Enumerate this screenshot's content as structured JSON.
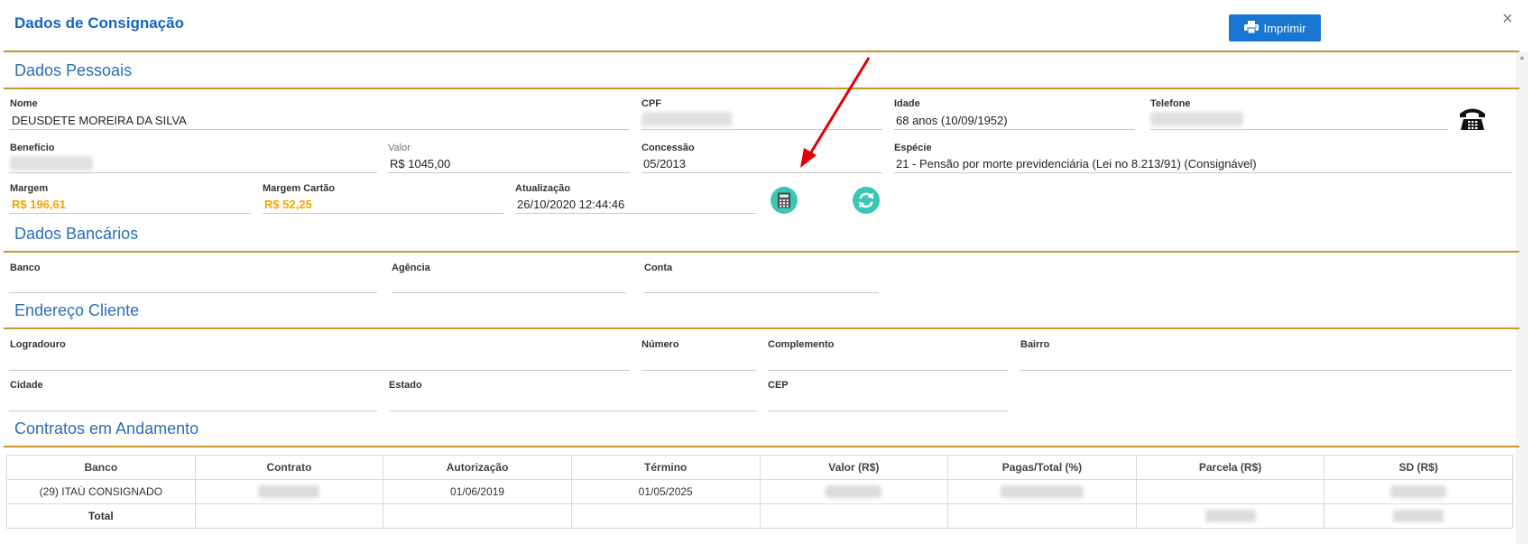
{
  "header": {
    "title": "Dados de Consignação",
    "print_label": "Imprimir",
    "close_symbol": "×"
  },
  "sections": {
    "personal": "Dados Pessoais",
    "bank": "Dados Bancários",
    "address": "Endereço Cliente",
    "contracts": "Contratos em Andamento"
  },
  "personal": {
    "nome_label": "Nome",
    "nome": "DEUSDETE MOREIRA DA SILVA",
    "cpf_label": "CPF",
    "idade_label": "Idade",
    "idade": "68 anos (10/09/1952)",
    "telefone_label": "Telefone",
    "beneficio_label": "Benefício",
    "valor_label": "Valor",
    "valor": "R$ 1045,00",
    "concessao_label": "Concessão",
    "concessao": "05/2013",
    "especie_label": "Espécie",
    "especie": "21 - Pensão por morte previdenciária (Lei no 8.213/91) (Consignável)",
    "margem_label": "Margem",
    "margem": "R$ 196,61",
    "margem_cartao_label": "Margem Cartão",
    "margem_cartao": "R$ 52,25",
    "atualizacao_label": "Atualização",
    "atualizacao": "26/10/2020 12:44:46"
  },
  "bank": {
    "banco_label": "Banco",
    "agencia_label": "Agência",
    "conta_label": "Conta"
  },
  "address": {
    "logradouro_label": "Logradouro",
    "numero_label": "Número",
    "complemento_label": "Complemento",
    "bairro_label": "Bairro",
    "cidade_label": "Cidade",
    "estado_label": "Estado",
    "cep_label": "CEP"
  },
  "contracts": {
    "columns": [
      "Banco",
      "Contrato",
      "Autorização",
      "Término",
      "Valor (R$)",
      "Pagas/Total (%)",
      "Parcela (R$)",
      "SD (R$)"
    ],
    "row": {
      "banco": "(29) ITAÚ CONSIGNADO",
      "autorizacao": "01/06/2019",
      "termino": "01/05/2025"
    },
    "total_label": "Total"
  },
  "icons": {
    "print": "printer-icon",
    "phone": "phone-icon",
    "calculator": "calculator-icon",
    "refresh": "refresh-icon",
    "arrow": "annotation-arrow"
  },
  "colors": {
    "accent": "#1976d2",
    "divider": "#c7952a",
    "section": "#2a6eb8",
    "margin": "#f5a300",
    "teal": "#3cc7b5"
  }
}
